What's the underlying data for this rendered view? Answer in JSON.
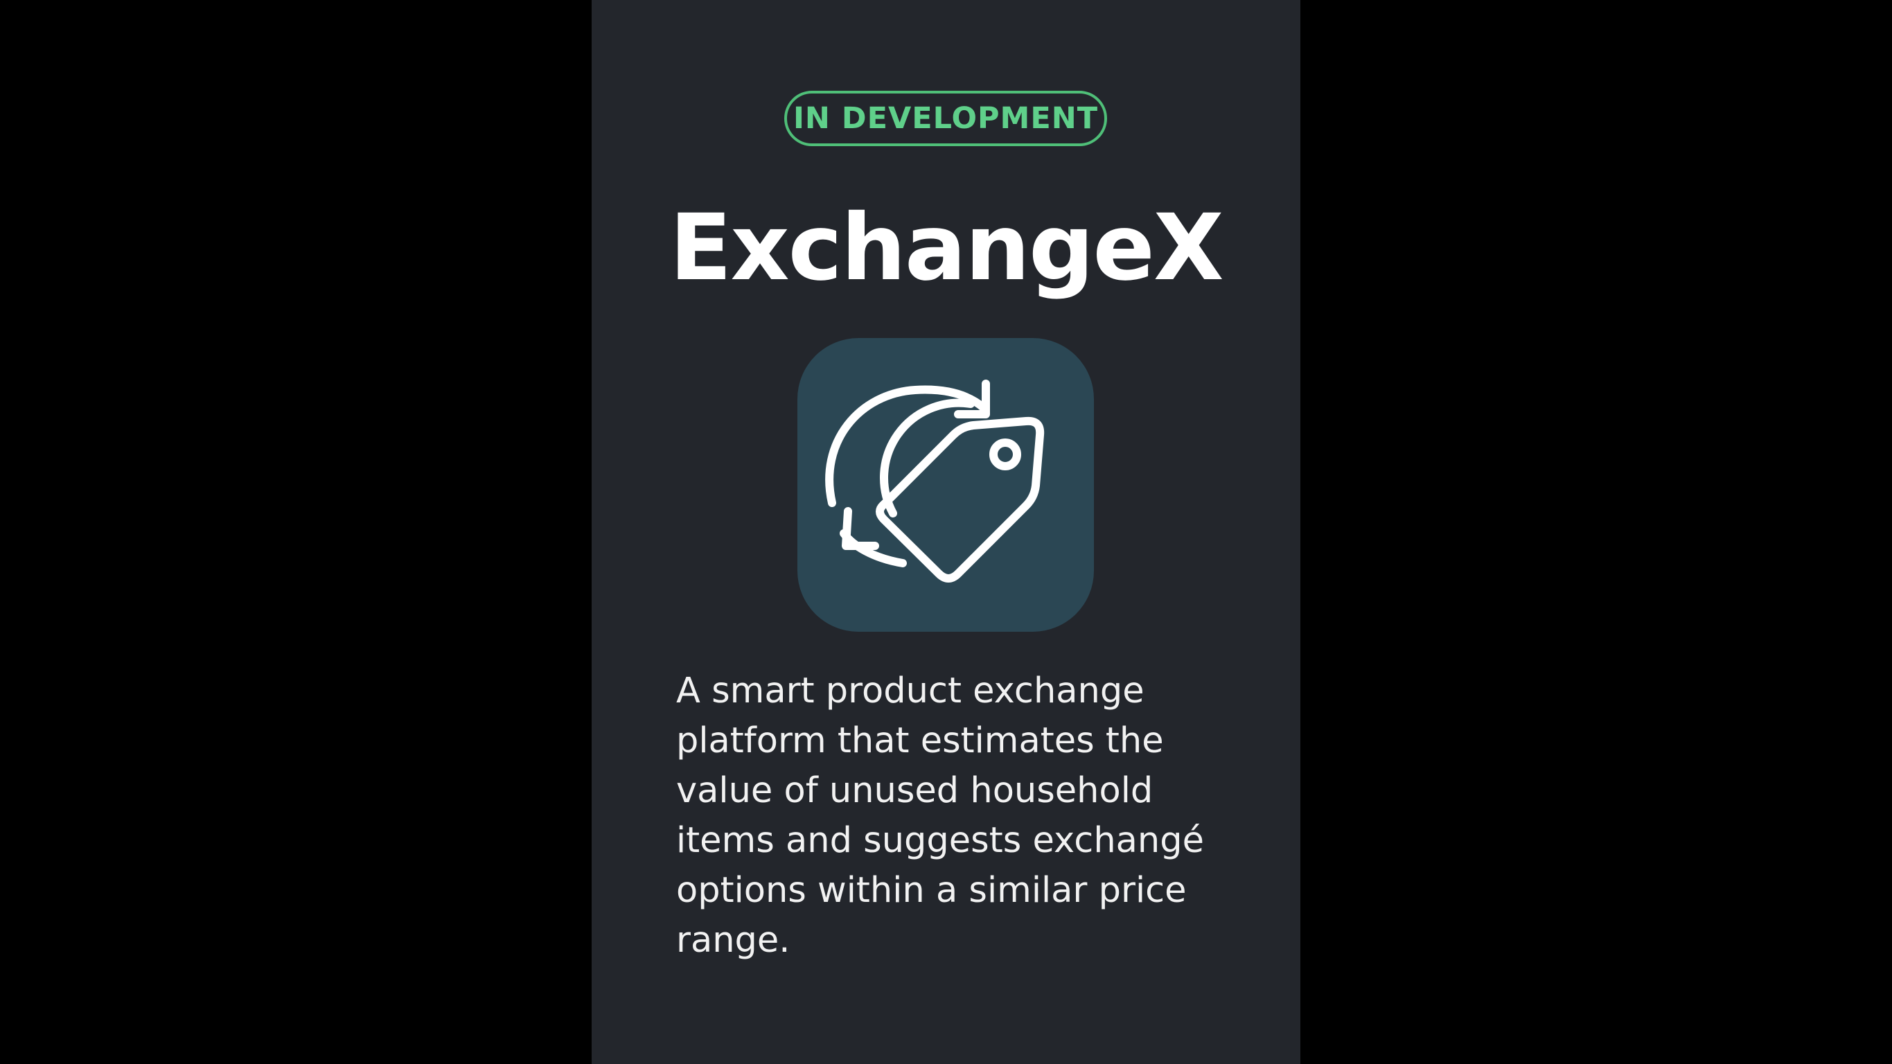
{
  "status_badge": {
    "label": "IN DEVELOPMENT",
    "color": "#5fd08a"
  },
  "app": {
    "name": "ExchangeX",
    "icon": "price-tag-exchange-icon",
    "icon_background": "#2b4754",
    "description": "A smart product exchange platform that estimates the value of unused household items and suggests exchangé options within a similar price range."
  },
  "colors": {
    "page_background": "#000000",
    "panel_background": "#23262c",
    "text": "#ffffff"
  }
}
